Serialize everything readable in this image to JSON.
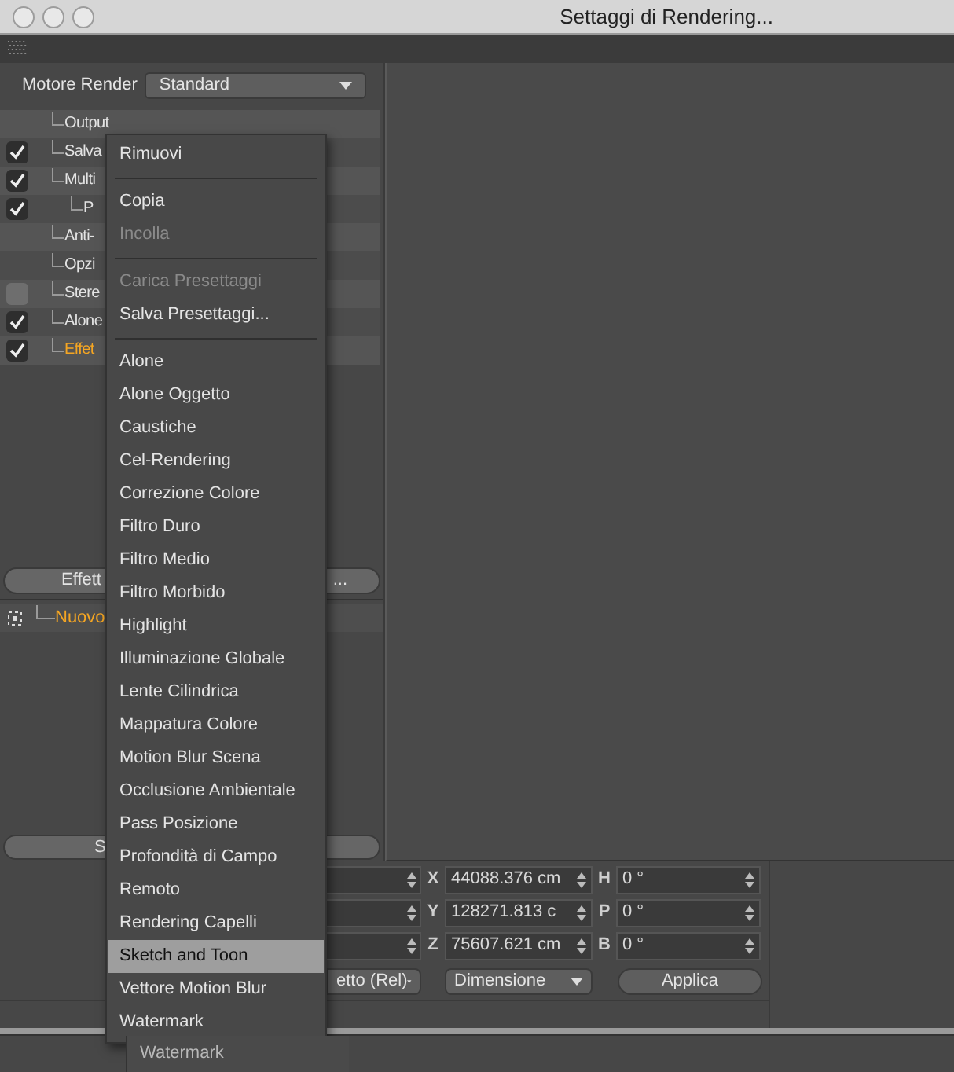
{
  "window": {
    "title": "Settaggi di Rendering..."
  },
  "render_engine": {
    "label": "Motore Render",
    "value": "Standard"
  },
  "tree": [
    {
      "label": "Output",
      "kind": "plain",
      "selected": false
    },
    {
      "label": "Salva",
      "kind": "checkbox",
      "checked": true,
      "selected": false
    },
    {
      "label": "Multi",
      "kind": "checkbox",
      "checked": true,
      "selected": false,
      "children": [
        {
          "label": "P",
          "kind": "checkbox",
          "checked": true,
          "selected": false
        }
      ]
    },
    {
      "label": "Anti-",
      "kind": "plain",
      "selected": false
    },
    {
      "label": "Opzi",
      "kind": "plain",
      "selected": false
    },
    {
      "label": "Stere",
      "kind": "checkbox",
      "checked": false,
      "selected": false
    },
    {
      "label": "Alone",
      "kind": "checkbox",
      "checked": true,
      "selected": false
    },
    {
      "label": "Effet",
      "kind": "checkbox",
      "checked": true,
      "selected": true
    }
  ],
  "effects_button": {
    "label": "Effett",
    "label_end": "..."
  },
  "effects_list": [
    {
      "label": "Nuovo",
      "selected": true
    }
  ],
  "bottom_button": {
    "label": "S"
  },
  "coordinates": {
    "rows": [
      {
        "axis": "X",
        "value": "44088.376 cm",
        "angle_axis": "H",
        "angle": "0 °"
      },
      {
        "axis": "Y",
        "value": "128271.813 c",
        "angle_axis": "P",
        "angle": "0 °"
      },
      {
        "axis": "Z",
        "value": "75607.621 cm",
        "angle_axis": "B",
        "angle": "0 °"
      }
    ],
    "buttons": [
      {
        "label": "etto (Rel)",
        "kind": "dropdown"
      },
      {
        "label": "Dimensione",
        "kind": "dropdown"
      },
      {
        "label": "Applica",
        "kind": "button"
      }
    ]
  },
  "context_menu": {
    "items": [
      {
        "kind": "item",
        "label": "Rimuovi",
        "disabled": false,
        "selected": false
      },
      {
        "kind": "separator"
      },
      {
        "kind": "item",
        "label": "Copia",
        "disabled": false,
        "selected": false
      },
      {
        "kind": "item",
        "label": "Incolla",
        "disabled": true,
        "selected": false
      },
      {
        "kind": "separator"
      },
      {
        "kind": "item",
        "label": "Carica Presettaggi",
        "disabled": true,
        "selected": false
      },
      {
        "kind": "item",
        "label": "Salva Presettaggi...",
        "disabled": false,
        "selected": false
      },
      {
        "kind": "separator"
      },
      {
        "kind": "item",
        "label": "Alone",
        "disabled": false,
        "selected": false
      },
      {
        "kind": "item",
        "label": "Alone Oggetto",
        "disabled": false,
        "selected": false
      },
      {
        "kind": "item",
        "label": "Caustiche",
        "disabled": false,
        "selected": false
      },
      {
        "kind": "item",
        "label": "Cel-Rendering",
        "disabled": false,
        "selected": false
      },
      {
        "kind": "item",
        "label": "Correzione Colore",
        "disabled": false,
        "selected": false
      },
      {
        "kind": "item",
        "label": "Filtro Duro",
        "disabled": false,
        "selected": false
      },
      {
        "kind": "item",
        "label": "Filtro Medio",
        "disabled": false,
        "selected": false
      },
      {
        "kind": "item",
        "label": "Filtro Morbido",
        "disabled": false,
        "selected": false
      },
      {
        "kind": "item",
        "label": "Highlight",
        "disabled": false,
        "selected": false
      },
      {
        "kind": "item",
        "label": "Illuminazione Globale",
        "disabled": false,
        "selected": false
      },
      {
        "kind": "item",
        "label": "Lente Cilindrica",
        "disabled": false,
        "selected": false
      },
      {
        "kind": "item",
        "label": "Mappatura Colore",
        "disabled": false,
        "selected": false
      },
      {
        "kind": "item",
        "label": "Motion Blur Scena",
        "disabled": false,
        "selected": false
      },
      {
        "kind": "item",
        "label": "Occlusione Ambientale",
        "disabled": false,
        "selected": false
      },
      {
        "kind": "item",
        "label": "Pass Posizione",
        "disabled": false,
        "selected": false
      },
      {
        "kind": "item",
        "label": "Profondità di Campo",
        "disabled": false,
        "selected": false
      },
      {
        "kind": "item",
        "label": "Remoto",
        "disabled": false,
        "selected": false
      },
      {
        "kind": "item",
        "label": "Rendering Capelli",
        "disabled": false,
        "selected": false
      },
      {
        "kind": "item",
        "label": "Sketch and Toon",
        "disabled": false,
        "selected": true
      },
      {
        "kind": "item",
        "label": "Vettore Motion Blur",
        "disabled": false,
        "selected": false
      },
      {
        "kind": "item",
        "label": "Watermark",
        "disabled": false,
        "selected": false
      }
    ]
  },
  "tooltip": "Watermark"
}
